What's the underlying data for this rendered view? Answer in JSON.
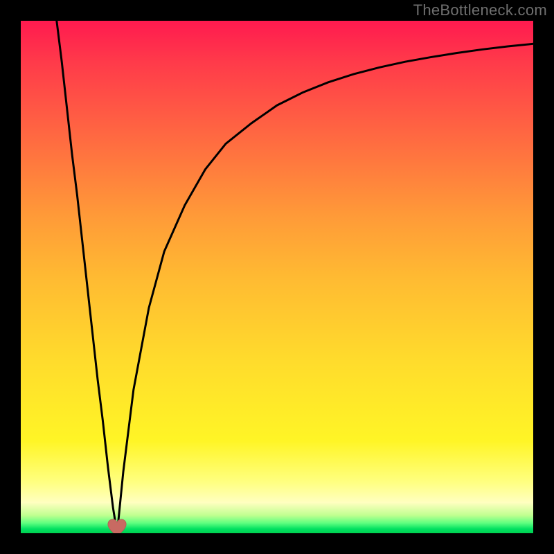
{
  "watermark": "TheBottleneck.com",
  "chart_data": {
    "type": "line",
    "title": "",
    "xlabel": "",
    "ylabel": "",
    "xlim": [
      0,
      100
    ],
    "ylim": [
      0,
      100
    ],
    "grid": false,
    "legend": false,
    "background_gradient_colors": [
      "#ff1a4f",
      "#ff9a38",
      "#ffff26",
      "#00e060"
    ],
    "series": [
      {
        "name": "left-branch",
        "x": [
          7,
          8,
          9,
          10,
          11,
          12,
          13,
          14,
          15,
          16,
          17,
          18,
          18.8
        ],
        "y": [
          100,
          92,
          83,
          74,
          66,
          57,
          48,
          39,
          30,
          22,
          13,
          5,
          0
        ]
      },
      {
        "name": "right-branch",
        "x": [
          18.8,
          20,
          22,
          25,
          28,
          32,
          36,
          40,
          45,
          50,
          55,
          60,
          65,
          70,
          75,
          80,
          85,
          90,
          95,
          100
        ],
        "y": [
          0,
          12,
          28,
          44,
          55,
          64,
          71,
          76,
          80,
          83.5,
          86,
          88,
          89.6,
          90.9,
          92,
          92.9,
          93.7,
          94.4,
          95,
          95.5
        ]
      }
    ],
    "marker": {
      "name": "optimal-point-heart",
      "x": 18.8,
      "y": 0,
      "color": "#c86a62"
    }
  }
}
